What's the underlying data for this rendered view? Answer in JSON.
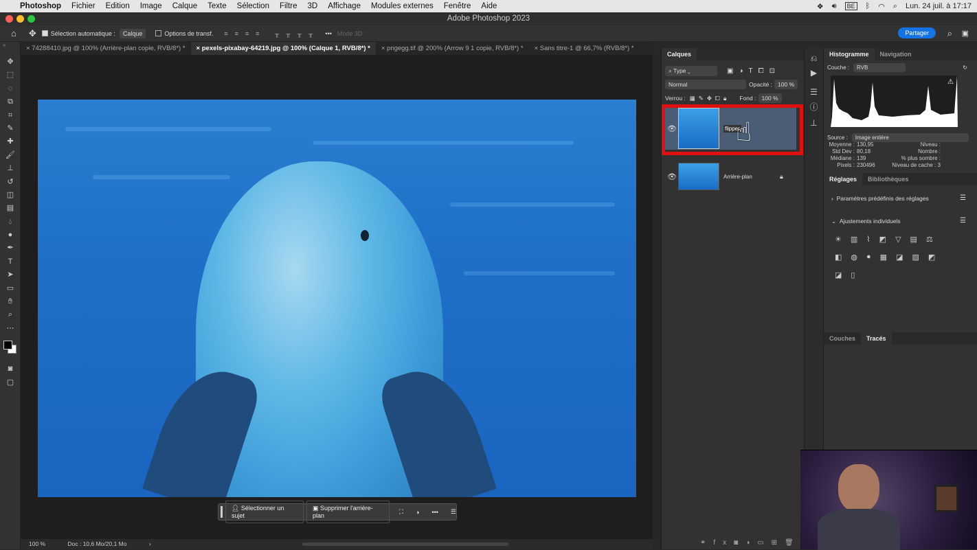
{
  "menubar": {
    "app": "Photoshop",
    "items": [
      "Fichier",
      "Edition",
      "Image",
      "Calque",
      "Texte",
      "Sélection",
      "Filtre",
      "3D",
      "Affichage",
      "Modules externes",
      "Fenêtre",
      "Aide"
    ],
    "keyboard": "BE",
    "datetime": "Lun. 24 juil. à 17:17"
  },
  "window": {
    "title": "Adobe Photoshop 2023"
  },
  "options": {
    "auto_select_label": "Sélection automatique :",
    "auto_select_value": "Calque",
    "transform_label": "Options de transf.",
    "mode3d": "Mode 3D :",
    "share": "Partager"
  },
  "tabs": [
    {
      "label": "74288410.jpg @ 100% (Arrière-plan copie, RVB/8*) *"
    },
    {
      "label": "pexels-pixabay-64219.jpg @ 100% (Calque 1, RVB/8*) *",
      "active": true
    },
    {
      "label": "pngegg.tif @ 200% (Arrow 9 1 copie, RVB/8*) *"
    },
    {
      "label": "Sans titre-1 @ 66,7% (RVB/8*) *"
    }
  ],
  "context_bar": {
    "select_subject": "Sélectionner un sujet",
    "remove_bg": "Supprimer l'arrière-plan",
    "more": "•••"
  },
  "status": {
    "zoom": "100 %",
    "doc": "Doc : 10,6 Mo/20,1 Mo"
  },
  "layers": {
    "title": "Calques",
    "filter": "Type",
    "blend": "Normal",
    "opacity_label": "Opacité :",
    "opacity": "100 %",
    "lock_label": "Verrou :",
    "fill_label": "Fond :",
    "fill": "100 %",
    "items": [
      {
        "name": "flipper",
        "editing": true,
        "selected": true
      },
      {
        "name": "Arrière-plan",
        "locked": true
      }
    ]
  },
  "histogram": {
    "tabs": [
      "Histogramme",
      "Navigation"
    ],
    "channel_label": "Couche :",
    "channel": "RVB",
    "source_label": "Source :",
    "source": "Image entière",
    "stats": {
      "Moyenne :": "130,95",
      "Std Dev :": "80,18",
      "Médiane :": "139",
      "Pixels :": "230496"
    },
    "stats_right": {
      "Niveau :": "",
      "Nombre :": "",
      "% plus sombre :": "",
      "Niveau de cache :": "3"
    }
  },
  "adjustments": {
    "tabs": [
      "Réglages",
      "Bibliothèques"
    ],
    "presets": "Paramètres prédéfinis des réglages",
    "individual": "Ajustements individuels"
  },
  "bottom_panel": {
    "tabs": [
      "Couches",
      "Tracés"
    ]
  },
  "colors": {
    "accent": "#1473e6",
    "highlight": "#e01010",
    "selected_layer": "#4a5d75"
  }
}
